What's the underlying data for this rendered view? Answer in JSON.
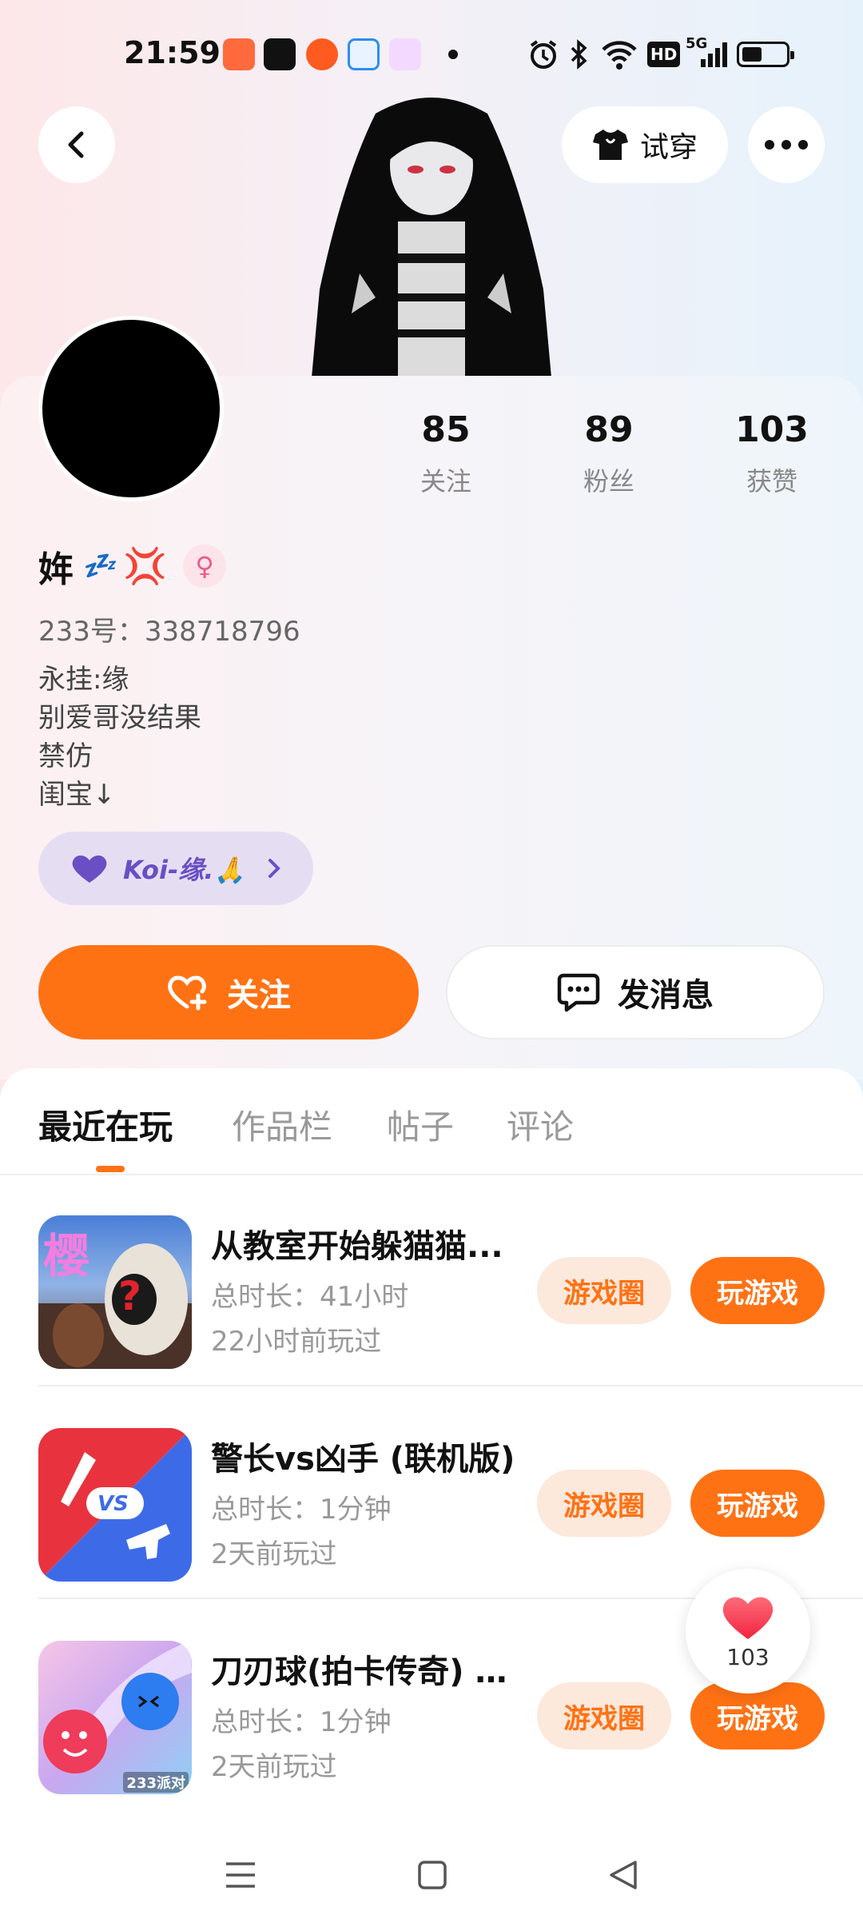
{
  "status_bar": {
    "time": "21:59",
    "network": "5G",
    "hd": "HD"
  },
  "header": {
    "try_on_label": "试穿"
  },
  "stats": [
    {
      "value": "85",
      "label": "关注"
    },
    {
      "value": "89",
      "label": "粉丝"
    },
    {
      "value": "103",
      "label": "获赞"
    }
  ],
  "profile": {
    "name": "姩",
    "zzz": "💤",
    "anger": "💢",
    "gender": "♀",
    "uid": "233号：338718796",
    "bio": [
      "永挂:缘",
      "别爱哥没结果",
      "禁仿",
      "闺宝↓"
    ],
    "tag": "Koi-缘.🙏"
  },
  "actions": {
    "follow_label": "关注",
    "message_label": "发消息"
  },
  "tabs": [
    "最近在玩",
    "作品栏",
    "帖子",
    "评论"
  ],
  "games": [
    {
      "title": "从教室开始躲猫猫...",
      "duration": "总时长：41小时",
      "last_played": "22小时前玩过",
      "circle_label": "游戏圈",
      "play_label": "玩游戏"
    },
    {
      "title": "警长vs凶手 (联机版)",
      "duration": "总时长：1分钟",
      "last_played": "2天前玩过",
      "circle_label": "游戏圈",
      "play_label": "玩游戏"
    },
    {
      "title": "刀刃球(拍卡传奇) -...",
      "duration": "总时长：1分钟",
      "last_played": "2天前玩过",
      "circle_label": "游戏圈",
      "play_label": "玩游戏"
    }
  ],
  "thumb_text": {
    "game1_char": "樱",
    "game1_q": "?",
    "game2_vs": "VS",
    "game3_badge": "233派对"
  },
  "float_like": {
    "count": "103"
  },
  "colors": {
    "accent": "#ff7214",
    "accent_light": "#fde8dc",
    "tag_bg": "#e5def3",
    "tag_text": "#6a4fc4"
  }
}
